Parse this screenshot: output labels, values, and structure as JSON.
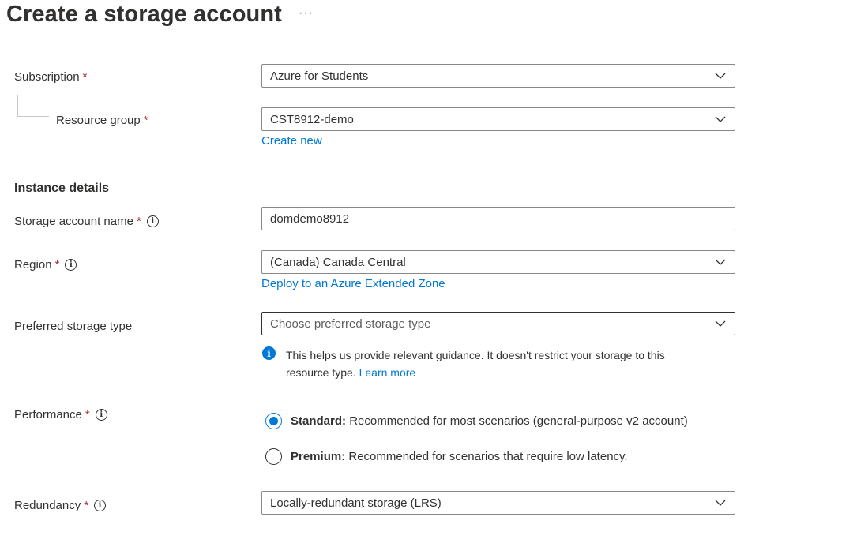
{
  "page": {
    "title": "Create a storage account",
    "more_label": "···"
  },
  "project": {
    "subscription": {
      "label": "Subscription",
      "required": "*",
      "value": "Azure for Students"
    },
    "resource_group": {
      "label": "Resource group",
      "required": "*",
      "value": "CST8912-demo",
      "create_link": "Create new"
    }
  },
  "instance": {
    "heading": "Instance details",
    "account_name": {
      "label": "Storage account name",
      "required": "*",
      "value": "domdemo8912"
    },
    "region": {
      "label": "Region",
      "required": "*",
      "value": "(Canada) Canada Central",
      "link": "Deploy to an Azure Extended Zone"
    },
    "storage_type": {
      "label": "Preferred storage type",
      "placeholder": "Choose preferred storage type",
      "info_text_1": "This helps us provide relevant guidance. It doesn't restrict your storage to this",
      "info_text_2": "resource type.",
      "learn_more": "Learn more"
    },
    "performance": {
      "label": "Performance",
      "required": "*",
      "options": [
        {
          "name": "Standard:",
          "desc": "Recommended for most scenarios (general-purpose v2 account)",
          "selected": true
        },
        {
          "name": "Premium:",
          "desc": "Recommended for scenarios that require low latency.",
          "selected": false
        }
      ]
    },
    "redundancy": {
      "label": "Redundancy",
      "required": "*",
      "value": "Locally-redundant storage (LRS)"
    }
  },
  "icons": {
    "info": "info-circle-icon",
    "chevron": "chevron-down-icon",
    "info_filled": "info-filled-icon"
  },
  "colors": {
    "accent": "#0078d4",
    "required": "#a4262c",
    "text": "#323130"
  }
}
